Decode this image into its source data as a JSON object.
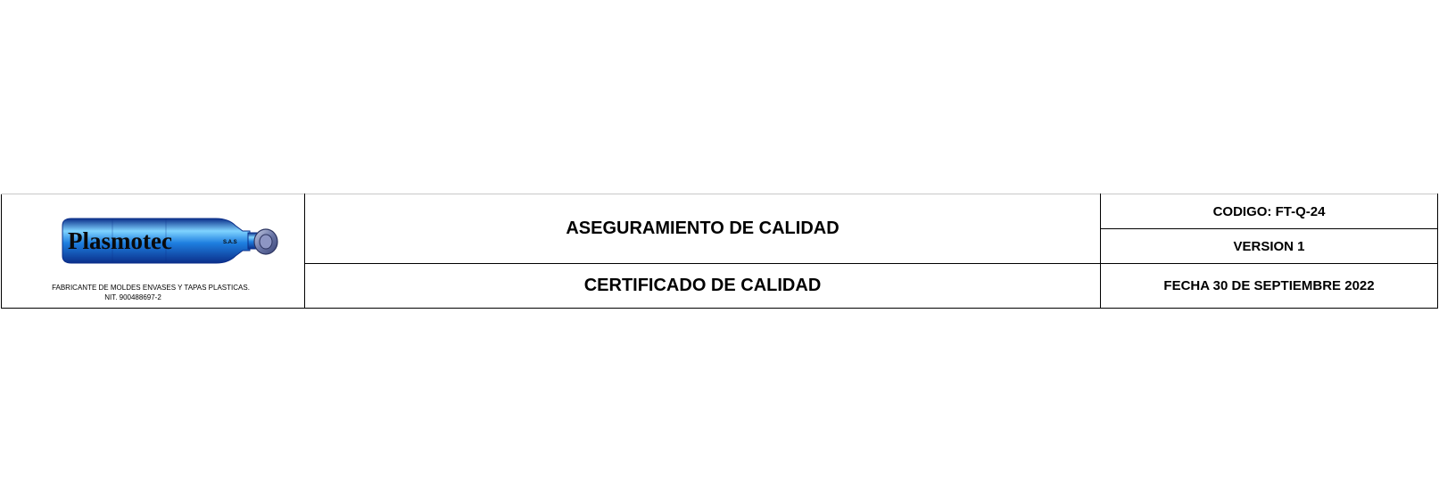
{
  "logo": {
    "brand": "Plasmotec",
    "suffix": "S.A.S",
    "tagline": "FABRICANTE DE MOLDES ENVASES Y TAPAS PLASTICAS.",
    "nit": "NIT. 900488697-2",
    "colors": {
      "bottle_light": "#7fd3ff",
      "bottle_mid": "#1e7fe0",
      "bottle_dark": "#0b2f8a",
      "cap": "#6b77a8",
      "text": "#0a0a0a"
    }
  },
  "header": {
    "area_title": "ASEGURAMIENTO DE CALIDAD",
    "document_title": "CERTIFICADO DE CALIDAD",
    "code": "CODIGO: FT-Q-24",
    "version": "VERSION 1",
    "date": "FECHA 30 DE SEPTIEMBRE 2022"
  }
}
